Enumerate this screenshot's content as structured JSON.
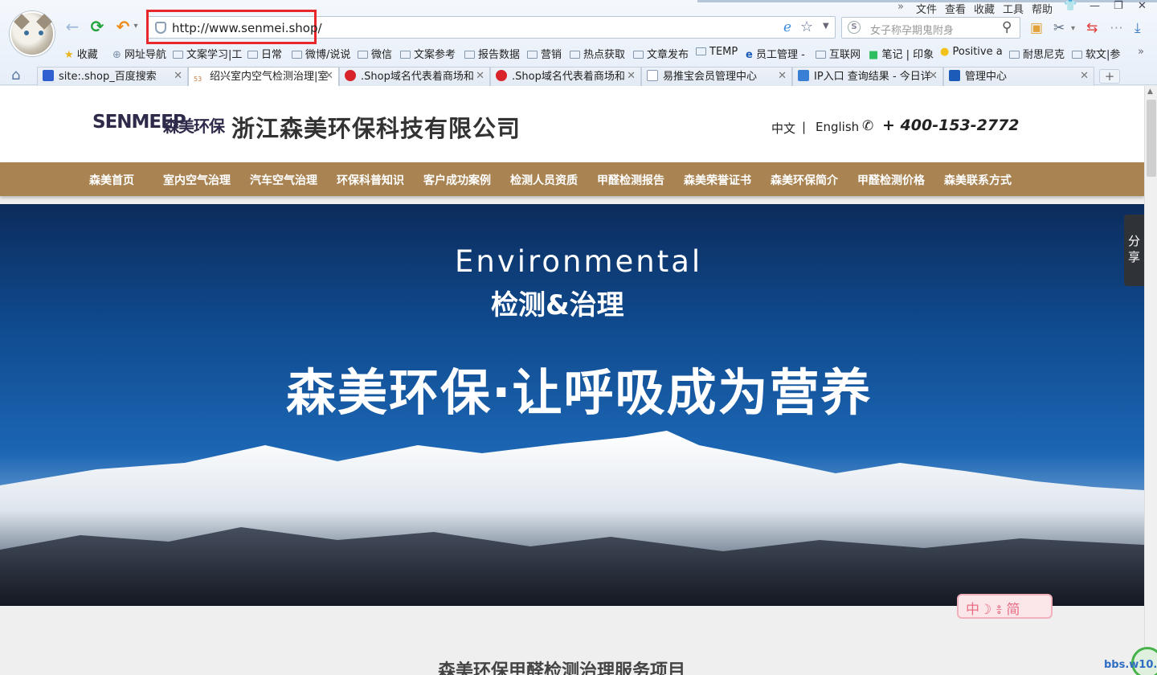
{
  "browser": {
    "menu": [
      "文件",
      "查看",
      "收藏",
      "工具",
      "帮助"
    ],
    "address": {
      "url": "http://www.senmei.shop/"
    },
    "search": {
      "placeholder": "女子称孕期鬼附身"
    },
    "bookmarks": [
      "收藏",
      "网址导航",
      "文案学习|工",
      "日常",
      "微博/说说",
      "微信",
      "文案参考",
      "报告数据",
      "营销",
      "热点获取",
      "文章发布",
      "TEMP",
      "员工管理 -",
      "互联网",
      "笔记 | 印象",
      "Positive a",
      "耐思尼克",
      "软文|参"
    ],
    "tabs": [
      {
        "title": "site:.shop_百度搜索",
        "active": false
      },
      {
        "title": "绍兴室内空气检测治理|室",
        "active": true
      },
      {
        "title": ".Shop域名代表着商场和",
        "active": false
      },
      {
        "title": ".Shop域名代表着商场和",
        "active": false
      },
      {
        "title": "易推宝会员管理中心",
        "active": false
      },
      {
        "title": "IP入口 查询结果 - 今日详",
        "active": false
      },
      {
        "title": "管理中心",
        "active": false
      }
    ],
    "overflow_label": "»"
  },
  "site": {
    "logo_text": "SENMEEP",
    "logo_cn": "森美环保",
    "company_name": "浙江森美环保科技有限公司",
    "lang_cn": "中文",
    "lang_sep": "|",
    "lang_en": "English",
    "phone_prefix": "+",
    "phone": "400-153-2772",
    "nav": [
      "森美首页",
      "室内空气治理",
      "汽车空气治理",
      "环保科普知识",
      "客户成功案例",
      "检测人员资质",
      "甲醛检测报告",
      "森美荣誉证书",
      "森美环保简介",
      "甲醛检测价格",
      "森美联系方式"
    ],
    "banner": {
      "title_en": "Environmental",
      "title_cn": "检测&治理",
      "slogan": "森美环保·让呼吸成为营养"
    },
    "share": [
      "分",
      "享"
    ],
    "ime_badge": "中☽ ៖ 简",
    "section_title": "森美环保甲醛检测治理服务项目",
    "watermark": "bbs.w10.cn"
  }
}
